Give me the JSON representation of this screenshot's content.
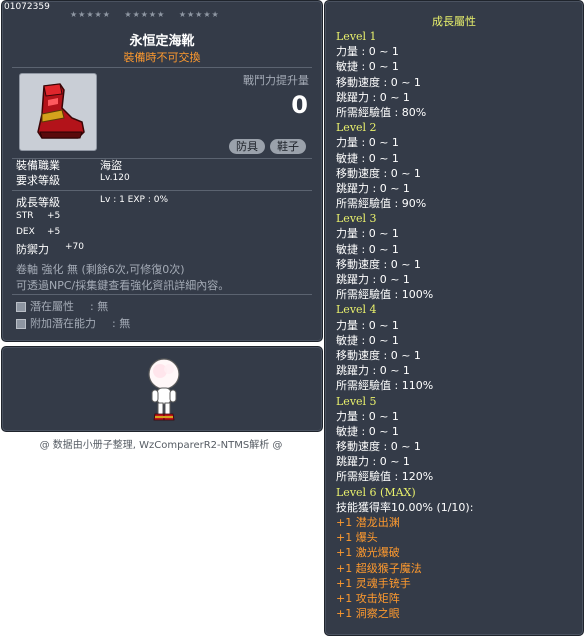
{
  "item": {
    "id": "01072359",
    "stars": [
      "★★★★★",
      "★★★★★",
      "★★★★★"
    ],
    "name": "永恒定海靴",
    "trade_note": "裝備時不可交換",
    "power_label": "戰鬥力提升量",
    "power_value": "0",
    "tags": [
      "防具",
      "鞋子"
    ],
    "job_label": "裝備職業",
    "job_value": "海盜",
    "req_level_label": "要求等級",
    "req_level_value": "Lv.120",
    "growth_label": "成長等級",
    "growth_value": "Lv : 1  EXP : 0%",
    "str_label": "STR",
    "str_value": "+5",
    "dex_label": "DEX",
    "dex_value": "+5",
    "def_label": "防禦力",
    "def_value": "+70",
    "scroll_line": "卷軸 強化 無 (剩餘6次,可修復0次)",
    "npc_note": "可透過NPC/採集鍵查看強化資訊詳細內容。",
    "potential_label": "潛在屬性",
    "potential_value": ": 無",
    "add_potential_label": "附加潛在能力",
    "add_potential_value": ": 無",
    "icon_name": "red-boot-icon"
  },
  "avatar": {
    "icon_name": "character-avatar"
  },
  "credit": "@ 数据由小册子整理, WzComparerR2-NTMS解析 @",
  "growth": {
    "title": "成長屬性",
    "levels": [
      {
        "label": "Level 1",
        "lines": [
          "力量 : 0 ~ 1",
          "敏捷 : 0 ~ 1",
          "移動速度 : 0 ~ 1",
          "跳躍力 : 0 ~ 1",
          "所需經驗值 : 80%"
        ]
      },
      {
        "label": "Level 2",
        "lines": [
          "力量 : 0 ~ 1",
          "敏捷 : 0 ~ 1",
          "移動速度 : 0 ~ 1",
          "跳躍力 : 0 ~ 1",
          "所需經驗值 : 90%"
        ]
      },
      {
        "label": "Level 3",
        "lines": [
          "力量 : 0 ~ 1",
          "敏捷 : 0 ~ 1",
          "移動速度 : 0 ~ 1",
          "跳躍力 : 0 ~ 1",
          "所需經驗值 : 100%"
        ]
      },
      {
        "label": "Level 4",
        "lines": [
          "力量 : 0 ~ 1",
          "敏捷 : 0 ~ 1",
          "移動速度 : 0 ~ 1",
          "跳躍力 : 0 ~ 1",
          "所需經驗值 : 110%"
        ]
      },
      {
        "label": "Level 5",
        "lines": [
          "力量 : 0 ~ 1",
          "敏捷 : 0 ~ 1",
          "移動速度 : 0 ~ 1",
          "跳躍力 : 0 ~ 1",
          "所需經驗值 : 120%"
        ]
      },
      {
        "label": "Level 6 (MAX)",
        "lines": [
          "技能獲得率10.00% (1/10):"
        ],
        "skills": [
          "+1 潜龙出渊",
          "+1 爆头",
          "+1 激光爆破",
          "+1 超级猴子魔法",
          "+1 灵魂手铳手",
          "+1 攻击矩阵",
          "+1 洞察之眼"
        ]
      }
    ]
  },
  "colors": {
    "panel_bg": "#343b48",
    "level_yellow": "#e8f06c",
    "orange": "#ff9a2e",
    "gray_text": "#a4abb6"
  }
}
